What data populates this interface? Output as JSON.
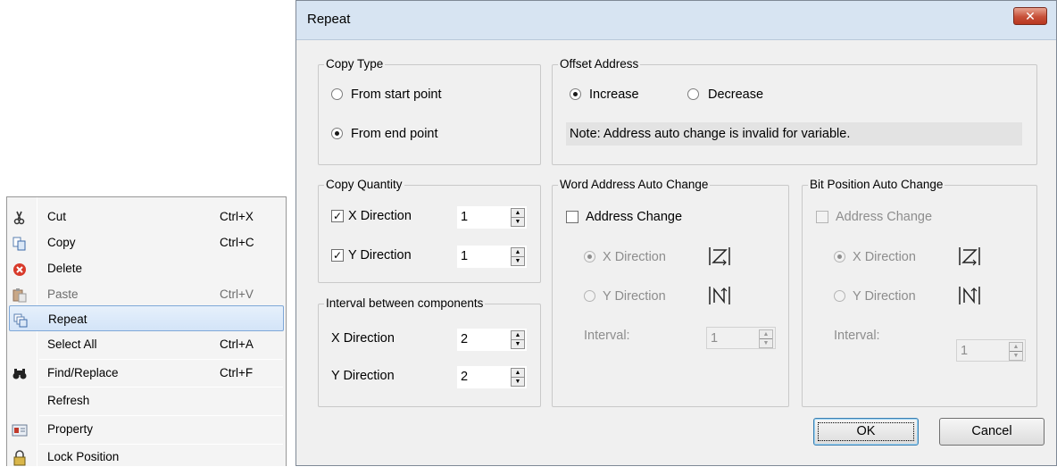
{
  "context_menu": {
    "items": [
      {
        "label": "Cut",
        "shortcut": "Ctrl+X",
        "icon": "scissors-icon"
      },
      {
        "label": "Copy",
        "shortcut": "Ctrl+C",
        "icon": "copy-icon"
      },
      {
        "label": "Delete",
        "shortcut": "",
        "icon": "delete-icon"
      },
      {
        "label": "Paste",
        "shortcut": "Ctrl+V",
        "icon": "paste-icon"
      },
      {
        "label": "Repeat",
        "shortcut": "",
        "icon": "repeat-icon"
      },
      {
        "label": "Select All",
        "shortcut": "Ctrl+A",
        "icon": ""
      },
      {
        "label": "Find/Replace",
        "shortcut": "Ctrl+F",
        "icon": "binoculars-icon"
      },
      {
        "label": "Refresh",
        "shortcut": "",
        "icon": ""
      },
      {
        "label": "Property",
        "shortcut": "",
        "icon": "property-icon"
      },
      {
        "label": "Lock Position",
        "shortcut": "",
        "icon": "lock-icon"
      }
    ]
  },
  "dialog": {
    "title": "Repeat",
    "close": "✕",
    "copy_type": {
      "legend": "Copy Type",
      "from_start": "From start point",
      "from_end": "From end point",
      "selected": "From end point"
    },
    "offset_address": {
      "legend": "Offset Address",
      "increase": "Increase",
      "decrease": "Decrease",
      "selected": "Increase",
      "note": "Note: Address auto change is invalid for variable."
    },
    "copy_quantity": {
      "legend": "Copy Quantity",
      "x_label": "X Direction",
      "x_value": "1",
      "x_checked": true,
      "y_label": "Y Direction",
      "y_value": "1",
      "y_checked": true
    },
    "interval": {
      "legend": "Interval between components",
      "x_label": "X Direction",
      "x_value": "2",
      "y_label": "Y Direction",
      "y_value": "2"
    },
    "word_address": {
      "legend": "Word Address Auto Change",
      "address_change": "Address Change",
      "x_direction": "X Direction",
      "y_direction": "Y Direction",
      "interval_label": "Interval:",
      "interval_value": "1"
    },
    "bit_position": {
      "legend": "Bit Position Auto Change",
      "address_change": "Address Change",
      "x_direction": "X Direction",
      "y_direction": "Y Direction",
      "interval_label": "Interval:",
      "interval_value": "1"
    },
    "ok": "OK",
    "cancel": "Cancel"
  }
}
